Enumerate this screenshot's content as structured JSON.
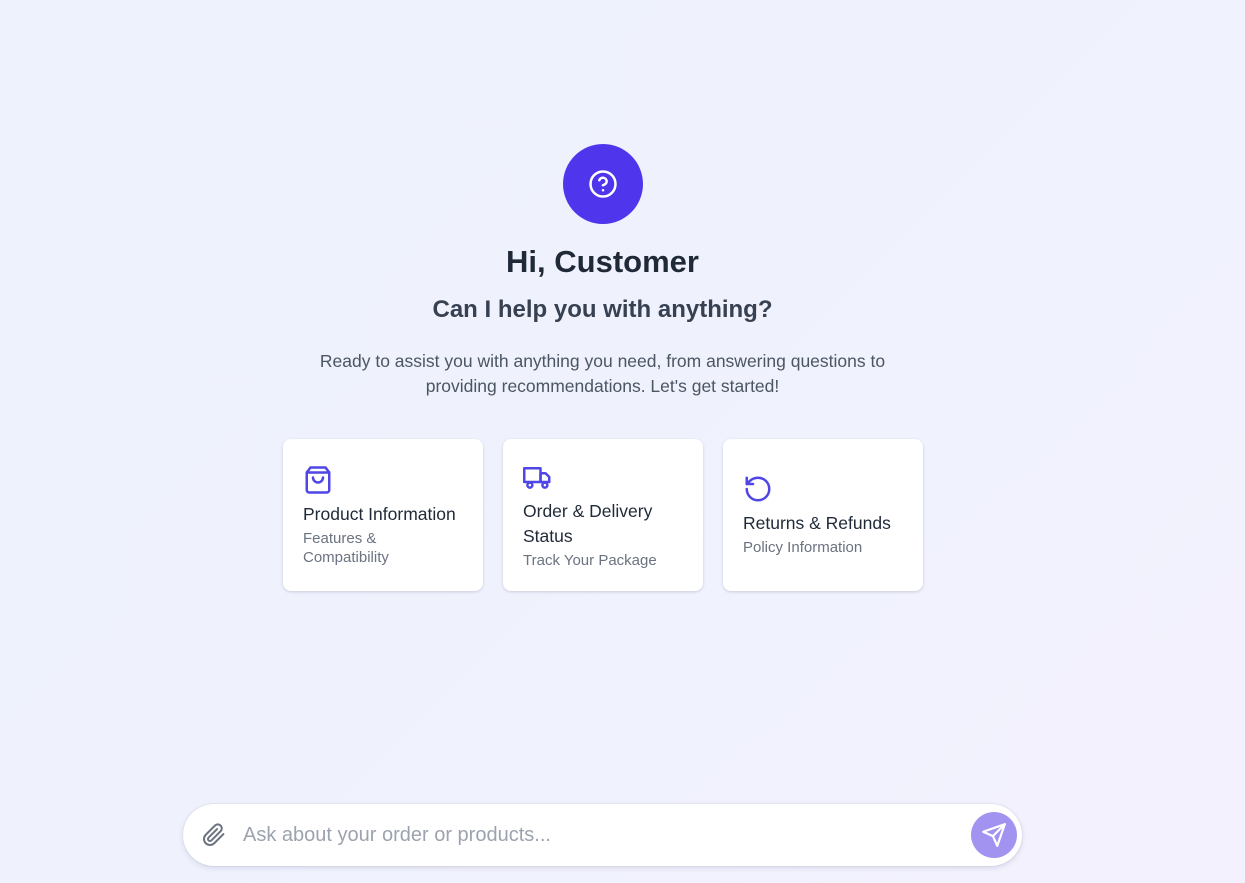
{
  "header": {
    "avatar_icon": "help-circle-icon",
    "greeting": "Hi, Customer",
    "question": "Can I help you with anything?",
    "description": "Ready to assist you with anything you need, from answering questions to providing recommendations. Let's get started!"
  },
  "cards": [
    {
      "icon": "shopping-bag-icon",
      "label": "Product Information",
      "sub": "Features & Compatibility"
    },
    {
      "icon": "truck-icon",
      "label": "Order & Delivery Status",
      "sub": "Track Your Package"
    },
    {
      "icon": "refresh-icon",
      "label": "Returns & Refunds",
      "sub": "Policy Information"
    }
  ],
  "composer": {
    "placeholder": "Ask about your order or products...",
    "value": "",
    "attach_icon": "paperclip-icon",
    "send_icon": "send-icon"
  },
  "colors": {
    "accent": "#4f35ec",
    "icon": "#4f46e5",
    "send_button": "#a393f0"
  }
}
